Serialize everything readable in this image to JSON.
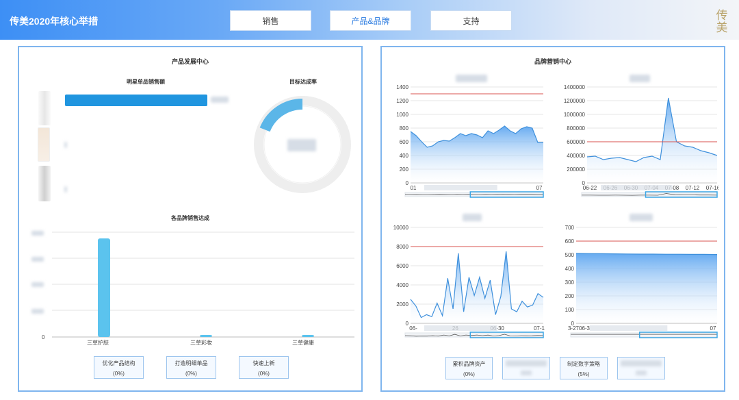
{
  "header": {
    "title": "传美2020年核心举措",
    "tabs": [
      {
        "label": "销售",
        "active": false
      },
      {
        "label": "产品&品牌",
        "active": true
      },
      {
        "label": "支持",
        "active": false
      }
    ],
    "logo_text": "传美"
  },
  "left_panel": {
    "title": "产品发展中心",
    "star_sales_title": "明星单品销售额",
    "target_title": "目标达成率",
    "brand_sales_title": "各品牌销售达成",
    "gauge_progress": 0.19,
    "star_bars": [
      {
        "fraction": 1.0
      },
      {
        "fraction": 0
      },
      {
        "fraction": 0
      }
    ],
    "brand_chart": {
      "zero_label": "0",
      "categories": [
        "三草护肤",
        "三草彩妆",
        "三草健康"
      ],
      "values": [
        0.94,
        0.02,
        0.02
      ]
    },
    "actions": [
      {
        "label": "优化产品结构",
        "value": "(0%)"
      },
      {
        "label": "打造明细单品",
        "value": "(0%)"
      },
      {
        "label": "快速上新",
        "value": "(0%)"
      }
    ]
  },
  "right_panel": {
    "title": "品牌营销中心",
    "actions": [
      {
        "label": "累积品牌资产",
        "value": "(0%)"
      },
      {
        "label": "",
        "value": ""
      },
      {
        "label": "制定数字策略",
        "value": "(5%)"
      },
      {
        "label": "",
        "value": ""
      }
    ]
  },
  "colors": {
    "accent": "#3d8ff5",
    "bar": "#2095df",
    "target_line": "#d9534f",
    "area": "#6aaef2",
    "gauge": "#5bb6e8"
  },
  "chart_data": [
    {
      "type": "area",
      "y_ticks": [
        "0",
        "200",
        "400",
        "600",
        "800",
        "1000",
        "1200",
        "1400"
      ],
      "ylim": [
        0,
        1400
      ],
      "target": 1300,
      "x_ticks": [
        "01",
        "07"
      ],
      "values": [
        750,
        690,
        600,
        520,
        540,
        600,
        620,
        610,
        660,
        720,
        690,
        720,
        700,
        660,
        760,
        720,
        770,
        830,
        760,
        720,
        790,
        820,
        800,
        590,
        590
      ]
    },
    {
      "type": "area",
      "y_ticks": [
        "0",
        "200000",
        "400000",
        "600000",
        "800000",
        "1000000",
        "1200000",
        "1400000"
      ],
      "ylim": [
        0,
        1400000
      ],
      "target": 600000,
      "x_ticks": [
        "06-22",
        "06-26",
        "06-30",
        "07-04",
        "07-08",
        "07-12",
        "07-16"
      ],
      "values": [
        380000,
        390000,
        340000,
        360000,
        370000,
        340000,
        310000,
        370000,
        390000,
        340000,
        1240000,
        600000,
        540000,
        520000,
        470000,
        440000,
        400000
      ]
    },
    {
      "type": "area",
      "y_ticks": [
        "0",
        "2000",
        "4000",
        "6000",
        "8000",
        "10000"
      ],
      "ylim": [
        0,
        10000
      ],
      "target": 8000,
      "x_ticks": [
        "06-",
        "26",
        "06-30",
        "07-1"
      ],
      "values": [
        2500,
        1800,
        600,
        900,
        700,
        2100,
        800,
        4700,
        1500,
        7300,
        1200,
        4800,
        2900,
        4800,
        2600,
        4500,
        900,
        2800,
        7500,
        1500,
        1200,
        2300,
        1700,
        1900,
        3100,
        2700
      ]
    },
    {
      "type": "area",
      "y_ticks": [
        "0",
        "100",
        "200",
        "300",
        "400",
        "500",
        "600",
        "700"
      ],
      "ylim": [
        0,
        700
      ],
      "target": 600,
      "x_ticks": [
        "3-2706-3",
        "07"
      ],
      "values": [
        510,
        509,
        508,
        507,
        506,
        505,
        505,
        504,
        504,
        503,
        503,
        502
      ]
    }
  ]
}
